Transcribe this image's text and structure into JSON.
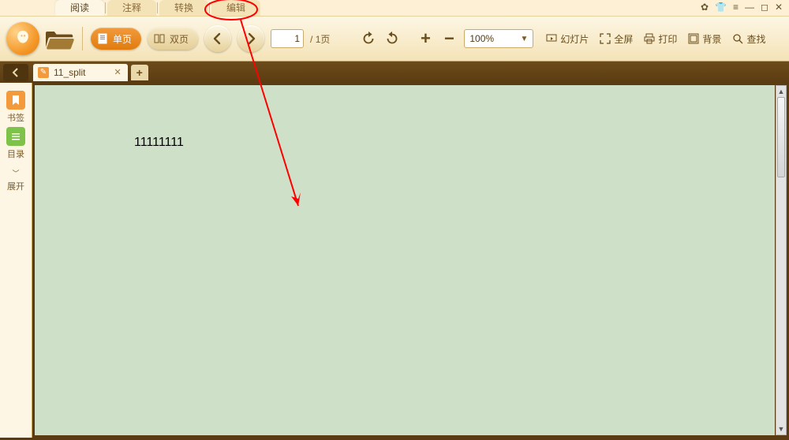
{
  "menu_tabs": {
    "read": "阅读",
    "comment": "注释",
    "convert": "转换",
    "edit": "编辑"
  },
  "toolbar": {
    "single_page": "单页",
    "double_page": "双页",
    "page_current": "1",
    "page_total": "/ 1页",
    "zoom_value": "100%"
  },
  "right_tools": {
    "slideshow": "幻灯片",
    "fullscreen": "全屏",
    "print": "打印",
    "background": "背景",
    "find": "查找"
  },
  "doc_tab": {
    "title": "11_split"
  },
  "sidebar": {
    "bookmark": "书签",
    "toc": "目录",
    "expand": "展开"
  },
  "document": {
    "body_text": "11111111"
  }
}
